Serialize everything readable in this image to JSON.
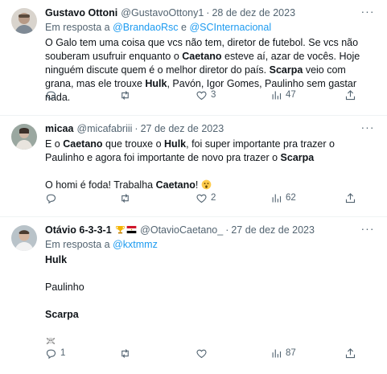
{
  "tweets": [
    {
      "display_name": "Gustavo Ottoni",
      "handle": "@GustavoOttony1",
      "dot": "·",
      "date": "28 de dez de 2023",
      "reply_prefix": "Em resposta a",
      "reply_mentions": [
        "@BrandaoRsc",
        "@SCInternacional"
      ],
      "reply_joiner": "e",
      "body": {
        "t1": "O Galo tem uma coisa que vcs não tem, diretor de futebol. Se vcs não souberam usufruir enquanto o ",
        "b1": "Caetano",
        "t2": " esteve aí, azar de vocês. Hoje ninguém discute quem é o melhor diretor do país. ",
        "b2": "Scarpa",
        "t3": " veio com grana, mas ele trouxe ",
        "b3": "Hulk",
        "t4": ", Pavón, Igor Gomes, Paulinho sem gastar nada."
      },
      "stats": {
        "replies": "",
        "retweets": "",
        "likes": "3",
        "views": "47"
      }
    },
    {
      "display_name": "micaa",
      "handle": "@micafabriii",
      "dot": "·",
      "date": "27 de dez de 2023",
      "body": {
        "t1": "E o ",
        "b1": "Caetano",
        "t2": " que trouxe o ",
        "b2": "Hulk",
        "t3": ", foi super importante pra trazer o Paulinho e agora foi importante de novo pra trazer o ",
        "b3": "Scarpa",
        "p2_t1": "O homi é foda! Trabalha ",
        "p2_b1": "Caetano",
        "p2_t2": "!"
      },
      "stats": {
        "replies": "",
        "retweets": "",
        "likes": "2",
        "views": "62"
      }
    },
    {
      "display_name": "Otávio 6-3-3-1",
      "handle": "@OtavioCaetano_",
      "dot": "·",
      "date": "27 de dez de 2023",
      "reply_prefix": "Em resposta a",
      "reply_mentions": [
        "@kxtmmz"
      ],
      "body": {
        "l1": "Hulk",
        "l2": "Paulinho",
        "l3": "Scarpa"
      },
      "stats": {
        "replies": "1",
        "retweets": "",
        "likes": "",
        "views": "87"
      }
    }
  ],
  "icons": {
    "more": "more-horizontal-icon",
    "reply": "reply-icon",
    "retweet": "retweet-icon",
    "like": "heart-icon",
    "views": "views-chart-icon",
    "share": "share-icon"
  },
  "colors": {
    "link": "#1d9bf0",
    "muted": "#536471",
    "text": "#0f1419"
  }
}
